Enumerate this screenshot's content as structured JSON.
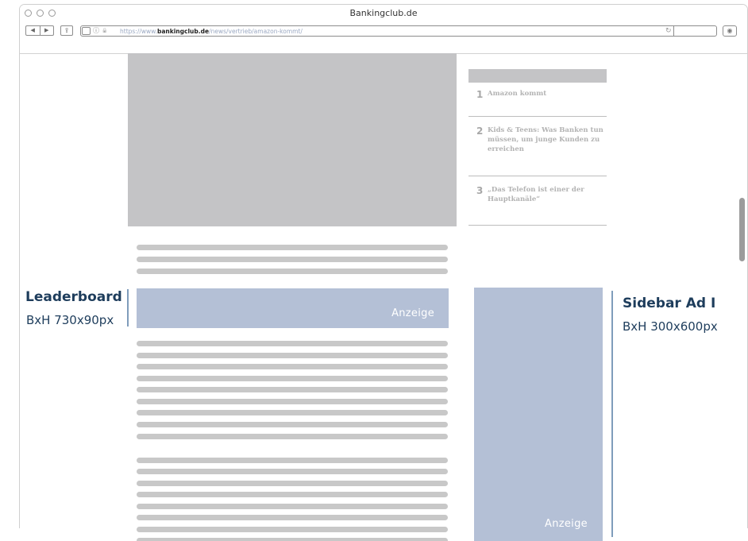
{
  "browser": {
    "title": "Bankingclub.de",
    "url": {
      "prefix": "https://www.",
      "host": "bankingclub.de",
      "path": "/news/vertrieb/amazon-kommt/"
    },
    "nav_back_glyph": "◀",
    "nav_forward_glyph": "▶",
    "share_glyph": "⇪",
    "info_glyph": "ⓘ",
    "lock_glyph": "🔒",
    "reload_glyph": "↻",
    "extension_glyph": "◉"
  },
  "popular": {
    "items": [
      {
        "number": "1",
        "title": "Amazon kommt"
      },
      {
        "number": "2",
        "title": "Kids & Teens: Was Banken tun müssen, um junge Kunden zu erreichen"
      },
      {
        "number": "3",
        "title": "„Das Telefon ist einer der Hauptkanäle“"
      }
    ]
  },
  "ads": {
    "leaderboard": {
      "label": "Anzeige",
      "callout_title": "Leaderboard",
      "callout_size": "BxH 730x90px"
    },
    "sidebar": {
      "label": "Anzeige",
      "callout_title": "Sidebar Ad I",
      "callout_size": "BxH 300x600px"
    }
  },
  "colors": {
    "placeholder_gray": "#c4c4c6",
    "ad_blue": "#b4c0d6",
    "callout_navy": "#1e3d5c",
    "callout_bar": "#7f9dbb"
  }
}
